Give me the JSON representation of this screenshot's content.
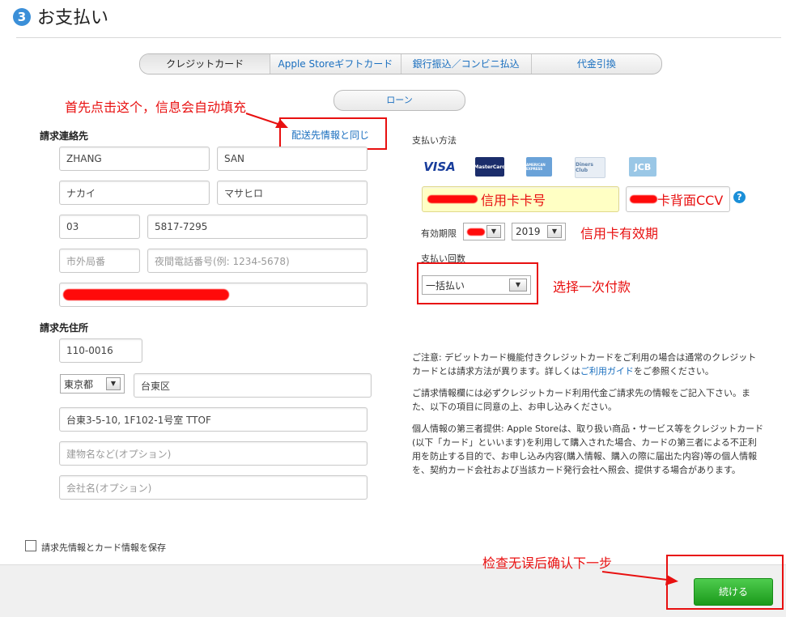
{
  "header": {
    "step": "3",
    "title": "お支払い"
  },
  "tabs": [
    "クレジットカード",
    "Apple Storeギフトカード",
    "銀行振込／コンビニ払込",
    "代金引換"
  ],
  "loan_button": "ローン",
  "annotations": {
    "autofill": "首先点击这个，信息会自动填充",
    "card_number": "信用卡卡号",
    "ccv": "卡背面CCV",
    "expiry": "信用卡有效期",
    "installment": "选择一次付款",
    "confirm": "检查无误后确认下一步"
  },
  "billing_contact": {
    "label": "請求連絡先",
    "same_as_shipping": "配送先情報と同じ",
    "last_name": "ZHANG",
    "first_name": "SAN",
    "last_name_kana": "ナカイ",
    "first_name_kana": "マサヒロ",
    "area_code": "03",
    "phone": "5817-7295",
    "night_area_placeholder": "市外局番",
    "night_phone_placeholder": "夜間電話番号(例: 1234-5678)"
  },
  "billing_address": {
    "label": "請求先住所",
    "postal": "110-0016",
    "prefecture": "東京都",
    "city": "台東区",
    "street": "台東3-5-10, 1F102-1号室 TTOF",
    "building_placeholder": "建物名など(オプション)",
    "company_placeholder": "会社名(オプション)"
  },
  "payment": {
    "label": "支払い方法",
    "cards": [
      "VISA",
      "MasterCard",
      "AMERICAN EXPRESS",
      "Diners Club",
      "JCB"
    ],
    "expiry_label": "有効期限",
    "expiry_year": "2019",
    "installment_label": "支払い回数",
    "installment_value": "一括払い",
    "help": "?"
  },
  "notes": {
    "p1_a": "ご注意: デビットカード機能付きクレジットカードをご利用の場合は通常のクレジットカードとは請求方法が異ります。詳しくは",
    "p1_link": "ご利用ガイド",
    "p1_b": "をご参照ください。",
    "p2": "ご請求情報欄には必ずクレジットカード利用代金ご請求先の情報をご記入下さい。また、以下の項目に同意の上、お申し込みください。",
    "p3": "個人情報の第三者提供: Apple Storeは、取り扱い商品・サービス等をクレジットカード(以下「カード」といいます)を利用して購入された場合、カードの第三者による不正利用を防止する目的で、お申し込み内容(購入情報、購入の際に届出た内容)等の個人情報を、契約カード会社および当該カード発行会社へ照会、提供する場合があります。"
  },
  "save_checkbox_label": "請求先情報とカード情報を保存",
  "continue_button": "続ける",
  "colors": {
    "accent": "#1a6fbf",
    "annotation": "#e81010",
    "continue": "#2fb32f",
    "highlight": "#ffffc4"
  }
}
